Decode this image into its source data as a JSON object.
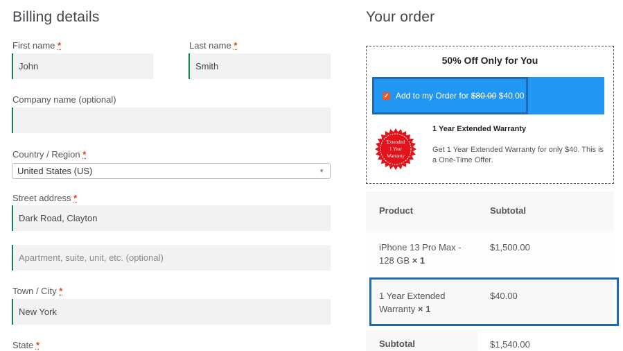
{
  "billing": {
    "title": "Billing details",
    "first_name_label": "First name",
    "last_name_label": "Last name",
    "required_mark": "*",
    "first_name_value": "John",
    "last_name_value": "Smith",
    "company_label": "Company name (optional)",
    "company_value": "",
    "country_label": "Country / Region",
    "country_value": "United States (US)",
    "street_label": "Street address",
    "street_value": "Dark Road, Clayton",
    "apartment_placeholder": "Apartment, suite, unit, etc. (optional)",
    "town_label": "Town / City",
    "town_value": "New York",
    "state_label": "State"
  },
  "order": {
    "title": "Your order",
    "offer": {
      "title": "50% Off Only for You",
      "add_label": "Add to my Order for",
      "old_price": "$80.00",
      "new_price": "$40.00",
      "seal_lines": [
        "Extended",
        "1 Year",
        "Warranty"
      ],
      "warranty_title": "1 Year Extended Warranty",
      "warranty_desc": "Get 1 Year Extended Warranty for only $40. This is a One-Time Offer."
    },
    "table": {
      "col_product": "Product",
      "col_subtotal": "Subtotal",
      "rows": [
        {
          "name_line1": "iPhone 13 Pro Max -",
          "name_line2": "128 GB",
          "qty": "× 1",
          "price": "$1,500.00"
        },
        {
          "name_line1": "1 Year Extended",
          "name_line2": "Warranty",
          "qty": "× 1",
          "price": "$40.00"
        }
      ],
      "subtotal_label": "Subtotal",
      "subtotal_value": "$1,540.00"
    },
    "colors": {
      "accent_blue": "#2196f3",
      "highlight_border": "#1d6bb3",
      "seal_red": "#e3121b",
      "field_accent": "#0f834d"
    }
  }
}
